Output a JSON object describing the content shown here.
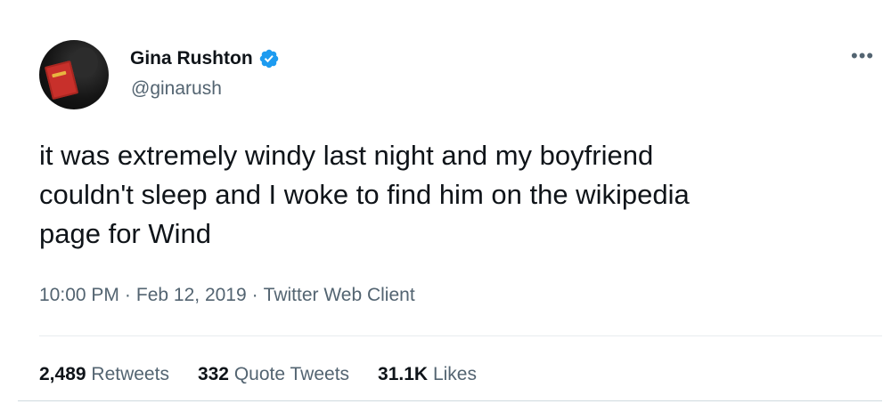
{
  "user": {
    "display_name": "Gina Rushton",
    "handle": "@ginarush",
    "verified_icon": "verified-badge-icon",
    "verified_color": "#1d9bf0"
  },
  "more_icon": "more-options-icon",
  "tweet": {
    "text": "it was extremely windy last night and my boyfriend\ncouldn't sleep and I woke to find him on the wikipedia\npage for Wind",
    "time": "10:00 PM",
    "date": "Feb 12, 2019",
    "separator": "·",
    "source": "Twitter Web Client"
  },
  "stats": {
    "retweets_count": "2,489",
    "retweets_label": "Retweets",
    "quotes_count": "332",
    "quotes_label": "Quote Tweets",
    "likes_count": "31.1K",
    "likes_label": "Likes"
  }
}
